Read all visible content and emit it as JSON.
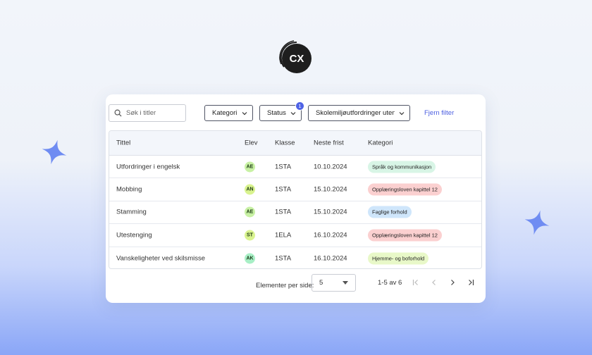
{
  "brand": {
    "logo_text": "CX"
  },
  "toolbar": {
    "search_placeholder": "Søk i titler",
    "filters": [
      {
        "label": "Kategori"
      },
      {
        "label": "Status",
        "badge": "1"
      },
      {
        "label": "Skolemiljøutfordringer uten..."
      }
    ],
    "clear_filters": "Fjern filter"
  },
  "table": {
    "headers": [
      "Tittel",
      "Elev",
      "Klasse",
      "Neste frist",
      "Kategori"
    ],
    "rows": [
      {
        "title": "Utfordringer i engelsk",
        "elev": "AE",
        "klasse": "1STA",
        "frist": "10.10.2024",
        "kategori": "Språk og kommunikasjon"
      },
      {
        "title": "Mobbing",
        "elev": "AN",
        "klasse": "1STA",
        "frist": "15.10.2024",
        "kategori": "Opplæringsloven kapittel 12"
      },
      {
        "title": "Stamming",
        "elev": "AE",
        "klasse": "1STA",
        "frist": "15.10.2024",
        "kategori": "Faglige forhold"
      },
      {
        "title": "Utestenging",
        "elev": "ST",
        "klasse": "1ELA",
        "frist": "16.10.2024",
        "kategori": "Opplæringsloven kapittel 12"
      },
      {
        "title": "Vanskeligheter ved skilsmisse",
        "elev": "AK",
        "klasse": "1STA",
        "frist": "16.10.2024",
        "kategori": "Hjemme- og boforhold"
      }
    ]
  },
  "pagination": {
    "per_page_label": "Elementer per side:",
    "per_page_value": "5",
    "range": "1-5 av 6"
  },
  "colors": {
    "accent": "#4f63e6",
    "avatar_green": "#c8f1a4",
    "avatar_teal": "#a8efc6",
    "pill_green": "#d8f5e6",
    "pill_red": "#fbd0d0",
    "pill_blue": "#cfe6fb",
    "pill_lime": "#e8f8c8"
  }
}
